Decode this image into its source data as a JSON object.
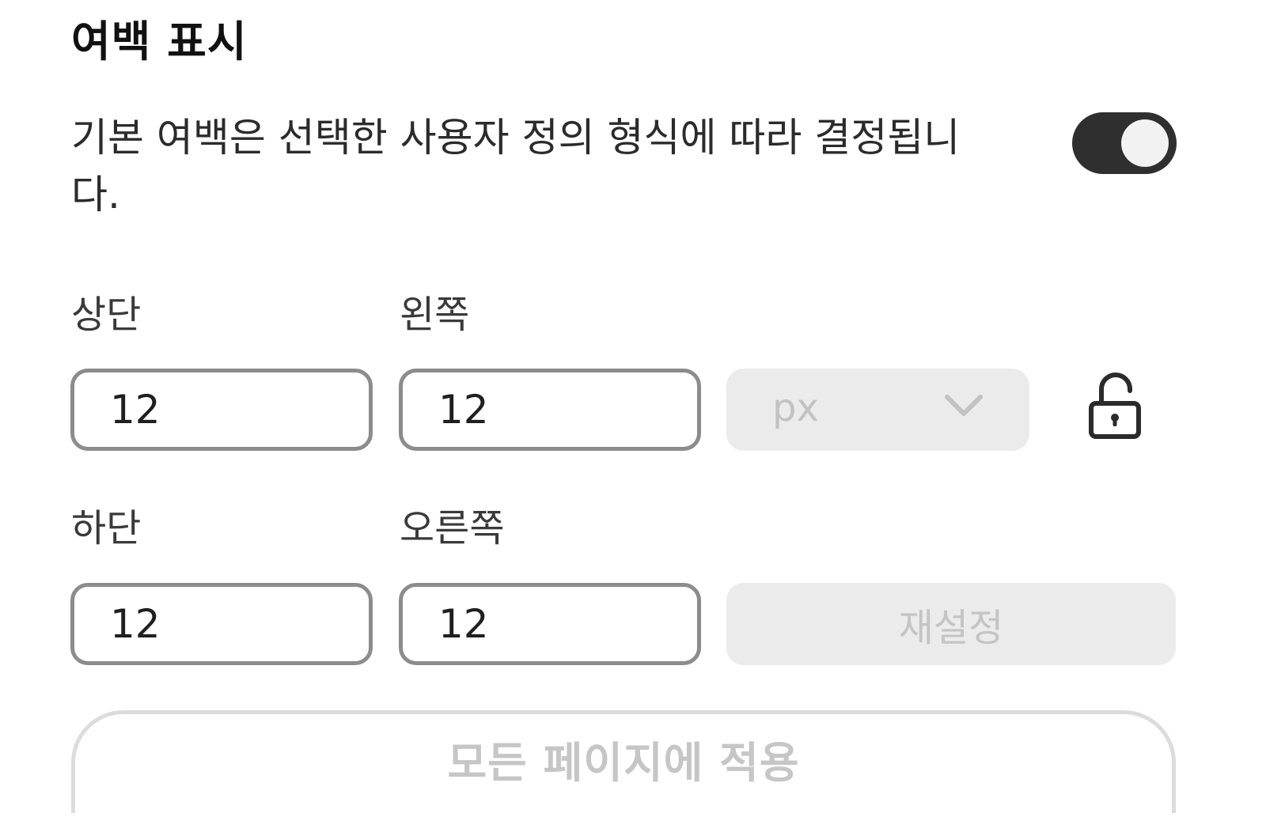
{
  "section": {
    "title": "여백 표시",
    "description": "기본 여백은 선택한 사용자 정의 형식에 따라 결정됩니다.",
    "toggle_on": true
  },
  "margins": {
    "top": {
      "label": "상단",
      "value": "12"
    },
    "left": {
      "label": "왼쪽",
      "value": "12"
    },
    "bottom": {
      "label": "하단",
      "value": "12"
    },
    "right": {
      "label": "오른쪽",
      "value": "12"
    }
  },
  "unit": {
    "selected": "px",
    "disabled": true
  },
  "lock": {
    "icon": "unlock-icon",
    "locked": false
  },
  "buttons": {
    "reset_label": "재설정",
    "apply_all_label": "모든 페이지에 적용"
  },
  "colors": {
    "toggle_track": "#2f2f2f",
    "input_border": "#8c8c8c",
    "disabled_bg": "#ebebeb",
    "disabled_text": "#c4c4c4"
  }
}
